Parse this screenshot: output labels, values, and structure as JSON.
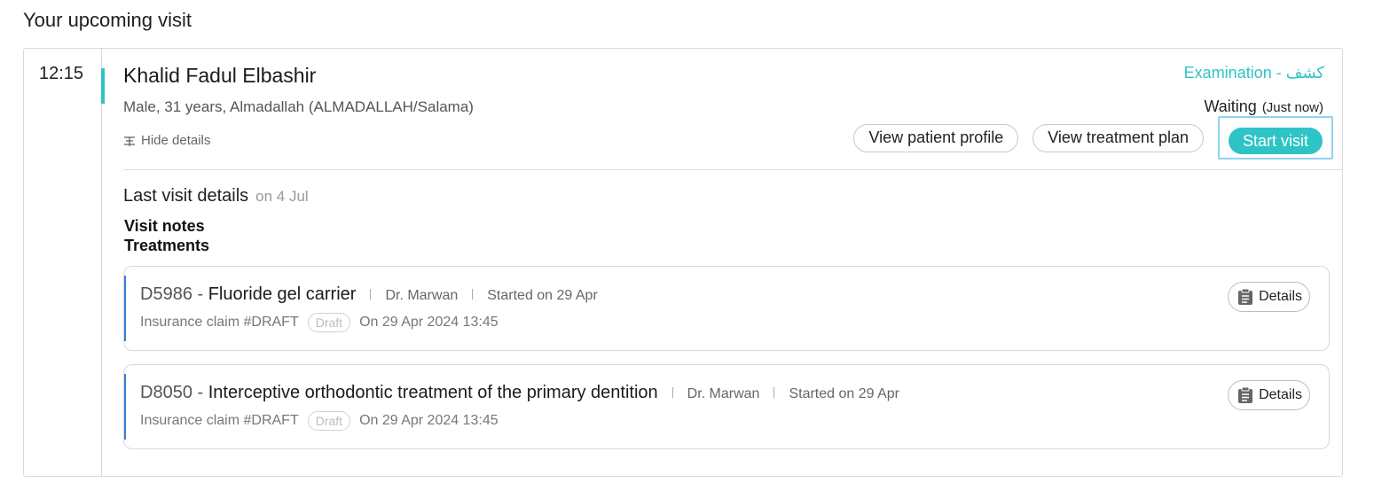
{
  "page": {
    "heading": "Your upcoming visit"
  },
  "visit": {
    "time": "12:15",
    "patient_name": "Khalid Fadul Elbashir",
    "patient_meta": "Male, 31 years, Almadallah (ALMADALLAH/Salama)",
    "hide_details_label": "Hide details",
    "visit_type": "Examination - كشف",
    "status": "Waiting",
    "status_time": "(Just now)",
    "buttons": {
      "view_profile": "View patient profile",
      "view_plan": "View treatment plan",
      "start_visit": "Start visit"
    },
    "accent_color": "#2ec4c6"
  },
  "last_visit": {
    "title": "Last visit details",
    "date": "on 4 Jul",
    "visit_notes_label": "Visit notes",
    "treatments_label": "Treatments",
    "treatments": [
      {
        "code": "D5986",
        "dash": " - ",
        "name": "Fluoride gel carrier",
        "doctor": "Dr. Marwan",
        "started": "Started on 29 Apr",
        "claim": "Insurance claim #DRAFT",
        "claim_status": "Draft",
        "claim_date": "On 29 Apr 2024 13:45",
        "details_label": "Details"
      },
      {
        "code": "D8050",
        "dash": " - ",
        "name": "Interceptive orthodontic treatment of the primary dentition",
        "doctor": "Dr. Marwan",
        "started": "Started on 29 Apr",
        "claim": "Insurance claim #DRAFT",
        "claim_status": "Draft",
        "claim_date": "On 29 Apr 2024 13:45",
        "details_label": "Details"
      }
    ]
  },
  "icons": {
    "hide_details": "filter-lines-icon",
    "details": "clipboard-icon"
  }
}
